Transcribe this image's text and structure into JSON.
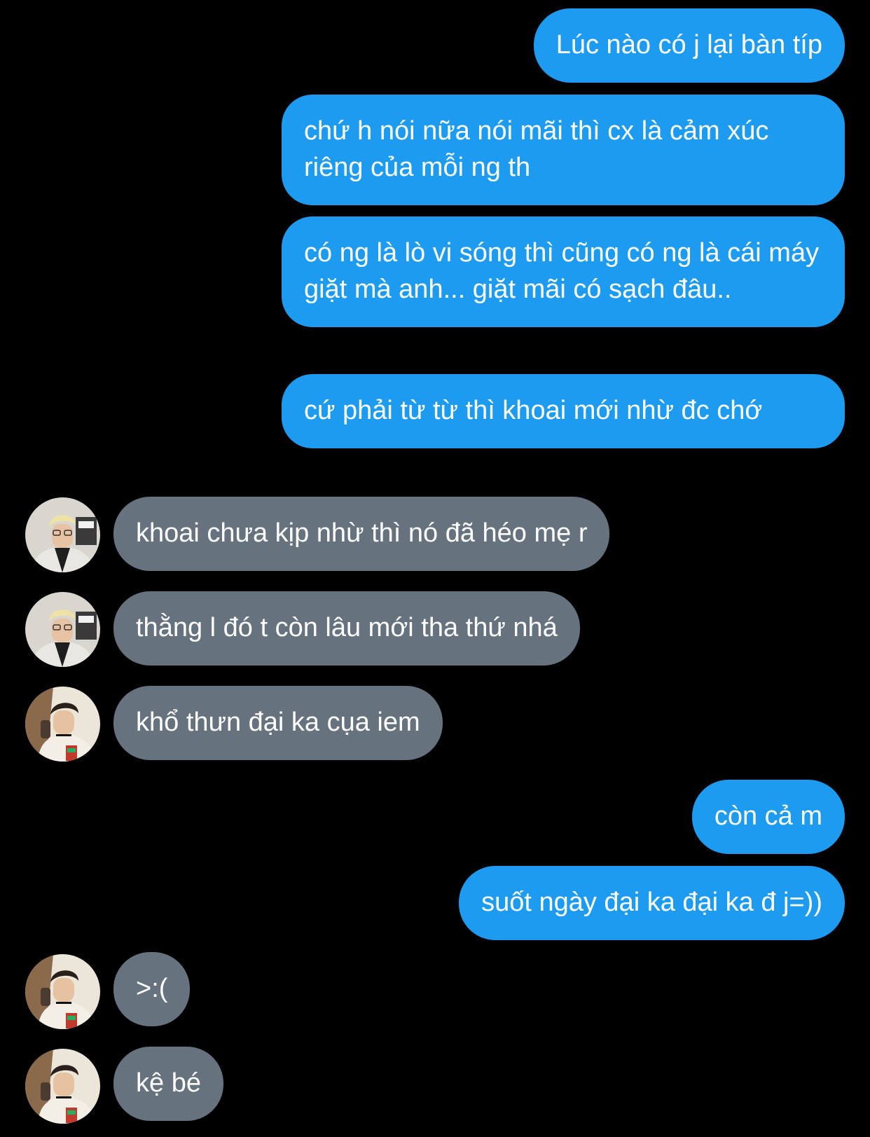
{
  "conversation": {
    "messages": [
      {
        "sender": "me",
        "text": "Lúc nào có j lại bàn típ"
      },
      {
        "sender": "me",
        "text": "chứ h nói nữa nói mãi thì cx là cảm xúc riêng của mỗi ng th"
      },
      {
        "sender": "me",
        "text": "có ng là lò vi sóng thì cũng có ng là cái máy giặt mà anh... giặt mãi có sạch đâu.."
      },
      {
        "sender": "me",
        "text": "cứ phải từ từ thì khoai mới nhừ đc chớ"
      },
      {
        "sender": "friend_1",
        "text": "khoai chưa kịp nhừ thì nó đã héo mẹ r"
      },
      {
        "sender": "friend_1",
        "text": "thằng l đó t còn lâu mới tha thứ nhá"
      },
      {
        "sender": "friend_2",
        "text": "khổ thưn đại ka cụa iem"
      },
      {
        "sender": "me",
        "text": "còn cả m"
      },
      {
        "sender": "me",
        "text": "suốt ngày đại ka đại ka đ j=))"
      },
      {
        "sender": "friend_2",
        "text": ">:("
      },
      {
        "sender": "friend_2",
        "text": "kệ bé"
      }
    ]
  },
  "colors": {
    "background": "#000000",
    "sent_bubble": "#1d9bf0",
    "received_bubble": "#66727e",
    "text": "#ffffff"
  },
  "icons": {
    "friend_1_avatar": "avatar-photo-blonde-person-jacket",
    "friend_2_avatar": "avatar-photo-person-cap-phone"
  }
}
